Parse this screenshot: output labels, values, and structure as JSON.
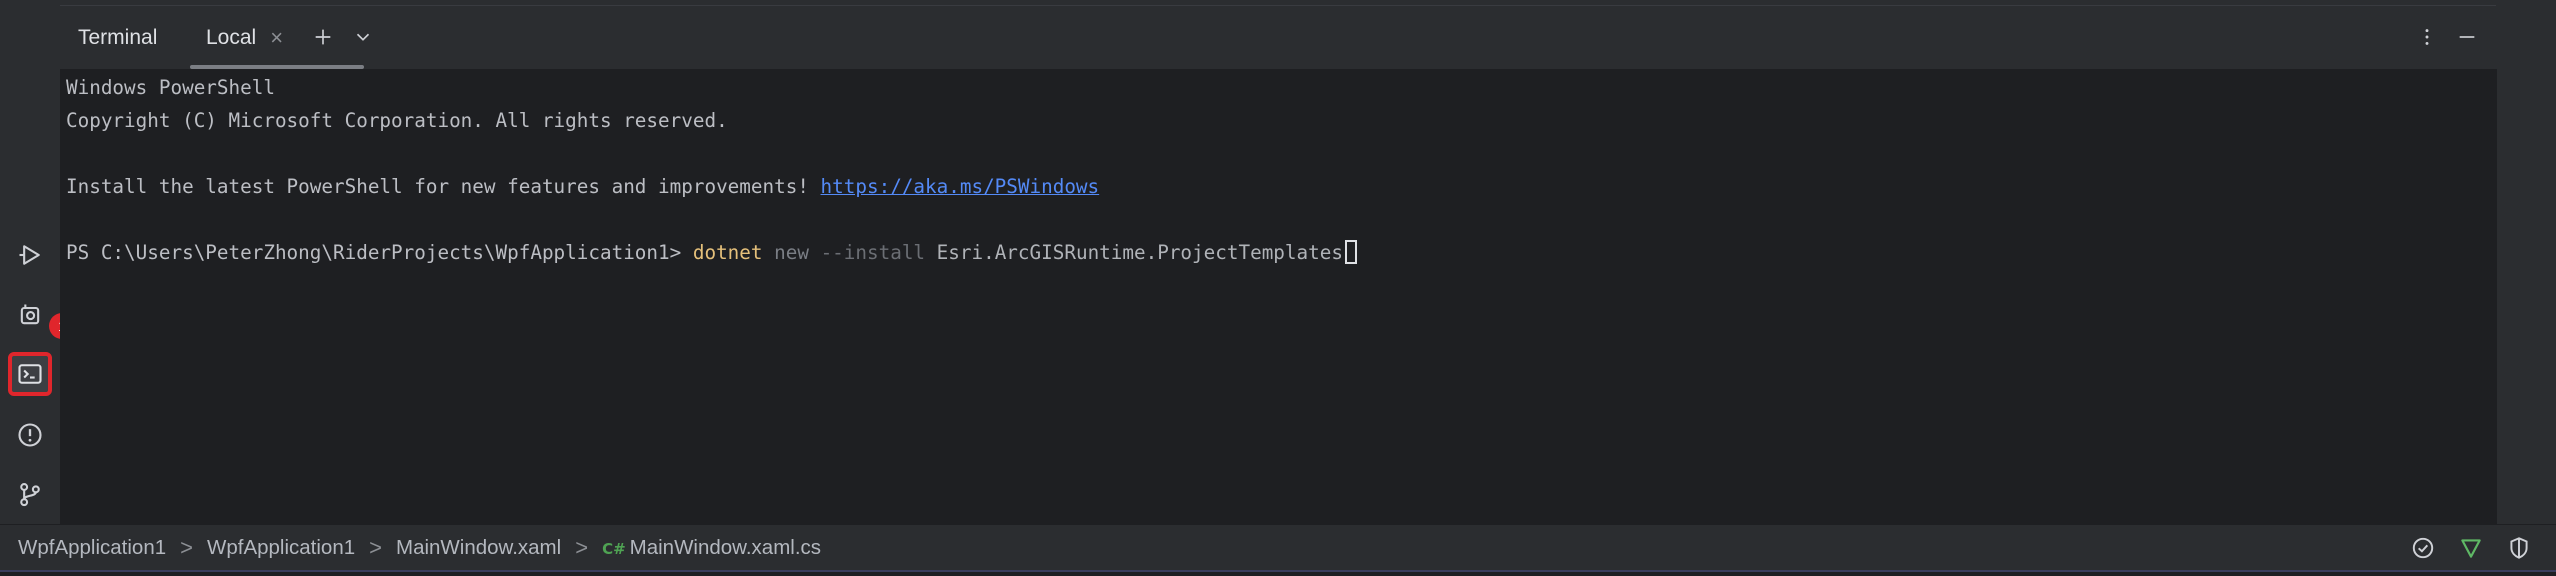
{
  "terminal": {
    "title": "Terminal",
    "tab_label": "Local",
    "close_glyph": "×",
    "lines": {
      "l1": "Windows PowerShell",
      "l2": "Copyright (C) Microsoft Corporation. All rights reserved.",
      "l3_text": "Install the latest PowerShell for new features and improvements! ",
      "l3_link": "https://aka.ms/PSWindows",
      "prompt": "PS C:\\Users\\PeterZhong\\RiderProjects\\WpfApplication1> ",
      "cmd": "dotnet",
      "arg_new": "new",
      "arg_flag": "--install",
      "arg_pkg": "Esri.ArcGISRuntime.ProjectTemplates"
    }
  },
  "sidebar": {
    "notification_count": "1",
    "icons": [
      "run-icon",
      "services-icon",
      "terminal-icon",
      "problems-icon",
      "git-icon"
    ]
  },
  "statusbar": {
    "breadcrumbs": [
      "WpfApplication1",
      "WpfApplication1",
      "MainWindow.xaml",
      "MainWindow.xaml.cs"
    ],
    "separator": ">",
    "cs_badge": "C#"
  },
  "colors": {
    "active_highlight": "#e0262c",
    "command": "#e5c07b",
    "link": "#548af7",
    "vcs_ok": "#5fb865"
  }
}
